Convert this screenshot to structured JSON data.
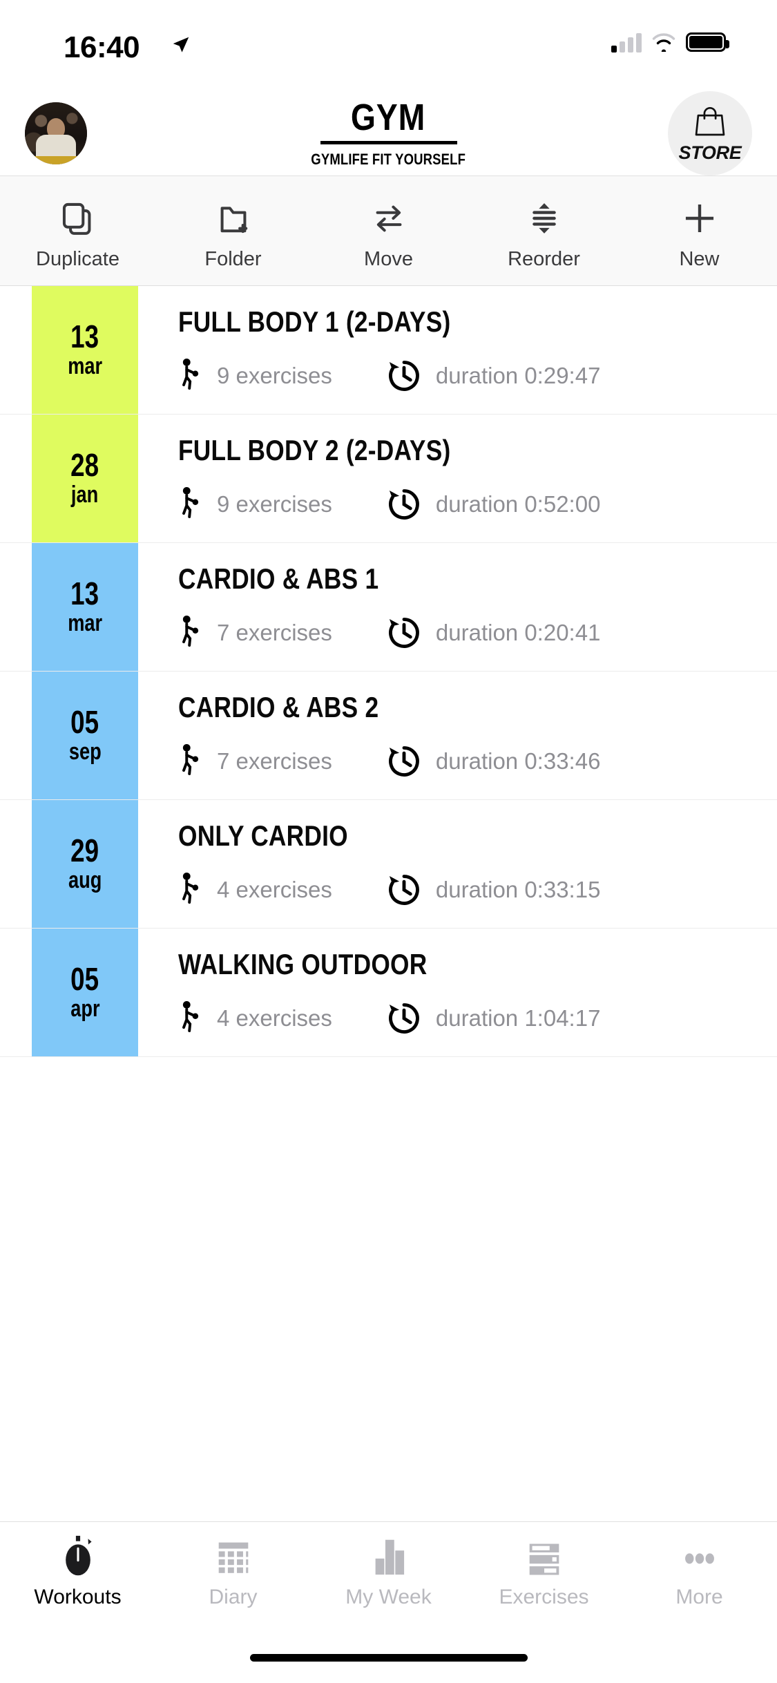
{
  "status_bar": {
    "time": "16:40",
    "location_icon": "location-arrow-icon",
    "signal_icon": "cellular-signal-icon",
    "wifi_icon": "wifi-icon",
    "battery_icon": "battery-full-icon"
  },
  "header": {
    "avatar": "user-avatar",
    "logo_title": "GYM",
    "logo_tagline": "GYMLIFE FIT YOURSELF",
    "store_label": "STORE",
    "store_icon": "shopping-bag-icon"
  },
  "toolbar": {
    "items": [
      {
        "label": "Duplicate",
        "icon": "duplicate-icon"
      },
      {
        "label": "Folder",
        "icon": "folder-add-icon"
      },
      {
        "label": "Move",
        "icon": "move-arrows-icon"
      },
      {
        "label": "Reorder",
        "icon": "reorder-icon"
      },
      {
        "label": "New",
        "icon": "plus-icon"
      }
    ]
  },
  "workouts": [
    {
      "day": "13",
      "month": "mar",
      "color": "yellow",
      "title": "FULL BODY 1 (2-DAYS)",
      "exercises": "9 exercises",
      "duration": "duration 0:29:47"
    },
    {
      "day": "28",
      "month": "jan",
      "color": "yellow",
      "title": "FULL BODY 2 (2-DAYS)",
      "exercises": "9 exercises",
      "duration": "duration 0:52:00"
    },
    {
      "day": "13",
      "month": "mar",
      "color": "blue",
      "title": "CARDIO & ABS 1",
      "exercises": "7 exercises",
      "duration": "duration 0:20:41"
    },
    {
      "day": "05",
      "month": "sep",
      "color": "blue",
      "title": "CARDIO & ABS 2",
      "exercises": "7 exercises",
      "duration": "duration 0:33:46"
    },
    {
      "day": "29",
      "month": "aug",
      "color": "blue",
      "title": "ONLY CARDIO",
      "exercises": "4 exercises",
      "duration": "duration 0:33:15"
    },
    {
      "day": "05",
      "month": "apr",
      "color": "blue",
      "title": "WALKING OUTDOOR",
      "exercises": "4 exercises",
      "duration": "duration 1:04:17"
    }
  ],
  "row_icons": {
    "exercises_icon": "person-exercise-icon",
    "duration_icon": "clock-history-icon"
  },
  "tabbar": {
    "items": [
      {
        "label": "Workouts",
        "icon": "stopwatch-icon",
        "active": true
      },
      {
        "label": "Diary",
        "icon": "calendar-grid-icon",
        "active": false
      },
      {
        "label": "My Week",
        "icon": "bar-chart-icon",
        "active": false
      },
      {
        "label": "Exercises",
        "icon": "list-rows-icon",
        "active": false
      },
      {
        "label": "More",
        "icon": "ellipsis-icon",
        "active": false
      }
    ]
  },
  "home_indicator": "home-indicator",
  "colors": {
    "tile_yellow": "#DFFB5F",
    "tile_blue": "#80C8F8",
    "toolbar_bg": "#F9F9F9",
    "store_bg": "#EFEFEF",
    "muted_text": "#8E8E93",
    "tab_inactive": "#B9B9BE"
  }
}
